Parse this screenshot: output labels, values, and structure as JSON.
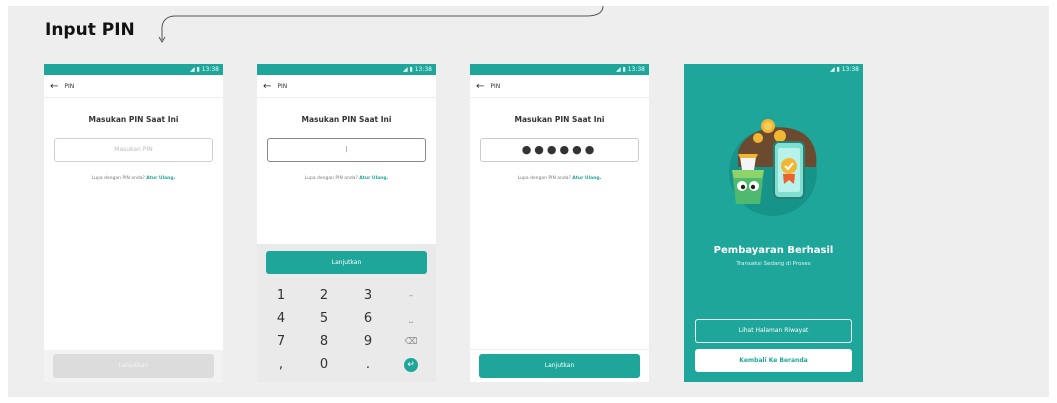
{
  "heading": "Input PIN",
  "status_time": "13:38",
  "appbar_title": "PIN",
  "pin_title": "Masukan PIN Saat Ini",
  "pin_placeholder": "Masukan PIN",
  "pin_cursor": "|",
  "pin_masked": "●●●●●●",
  "forgot_text": "Lupa dengan PIN anda?",
  "reset_link": "Atur Ulang.",
  "continue_label": "Lanjutkan",
  "keypad": {
    "k1": "1",
    "k2": "2",
    "k3": "3",
    "k4": "4",
    "k5": "5",
    "k6": "6",
    "k7": "7",
    "k8": "8",
    "k9": "9",
    "k0": "0",
    "dot": ".",
    "comma": ",",
    "minus": "–",
    "space": "⎵",
    "backspace": "⌫",
    "enter": "↵"
  },
  "success": {
    "title": "Pembayaran Berhasil",
    "subtitle": "Transaksi Sedang di Proses",
    "history_button": "Lihat Halaman Riwayat",
    "home_button": "Kembali Ke Beranda"
  },
  "colors": {
    "accent": "#1fa69a",
    "canvas": "#eeeeee"
  }
}
